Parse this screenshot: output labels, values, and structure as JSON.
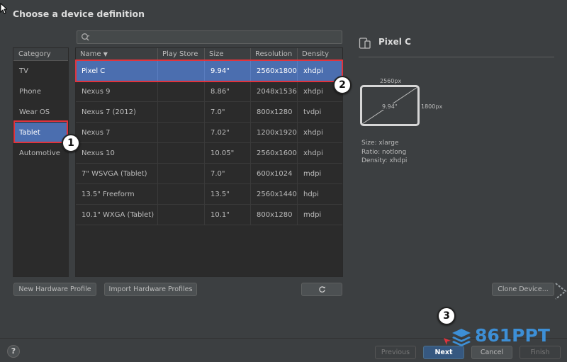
{
  "dialog": {
    "title": "Choose a device definition"
  },
  "search": {
    "placeholder": ""
  },
  "category": {
    "header": "Category",
    "items": [
      "TV",
      "Phone",
      "Wear OS",
      "Tablet",
      "Automotive"
    ]
  },
  "table": {
    "headers": [
      "Name",
      "Play Store",
      "Size",
      "Resolution",
      "Density"
    ],
    "rows": [
      [
        "Pixel C",
        "",
        "9.94\"",
        "2560x1800",
        "xhdpi"
      ],
      [
        "Nexus 9",
        "",
        "8.86\"",
        "2048x1536",
        "xhdpi"
      ],
      [
        "Nexus 7 (2012)",
        "",
        "7.0\"",
        "800x1280",
        "tvdpi"
      ],
      [
        "Nexus 7",
        "",
        "7.02\"",
        "1200x1920",
        "xhdpi"
      ],
      [
        "Nexus 10",
        "",
        "10.05\"",
        "2560x1600",
        "xhdpi"
      ],
      [
        "7\" WSVGA (Tablet)",
        "",
        "7.0\"",
        "600x1024",
        "mdpi"
      ],
      [
        "13.5\" Freeform",
        "",
        "13.5\"",
        "2560x1440",
        "hdpi"
      ],
      [
        "10.1\" WXGA (Tablet)",
        "",
        "10.1\"",
        "800x1280",
        "mdpi"
      ]
    ]
  },
  "preview": {
    "title": "Pixel C",
    "width_label": "2560px",
    "height_label": "1800px",
    "diagonal_label": "9.94\"",
    "size": "Size:     xlarge",
    "ratio": "Ratio:    notlong",
    "density": "Density: xhdpi"
  },
  "buttons": {
    "new_hw": "New Hardware Profile",
    "import_hw": "Import Hardware Profiles",
    "clone": "Clone Device...",
    "previous": "Previous",
    "next": "Next",
    "cancel": "Cancel",
    "finish": "Finish",
    "help": "?"
  },
  "annotations": {
    "one": "1",
    "two": "2",
    "three": "3"
  },
  "watermark": {
    "text": "861PPT",
    "color": "#3d8fd6"
  },
  "colors": {
    "selection": "#4b6eaf",
    "highlight": "#e0343d",
    "primary": "#365880"
  }
}
